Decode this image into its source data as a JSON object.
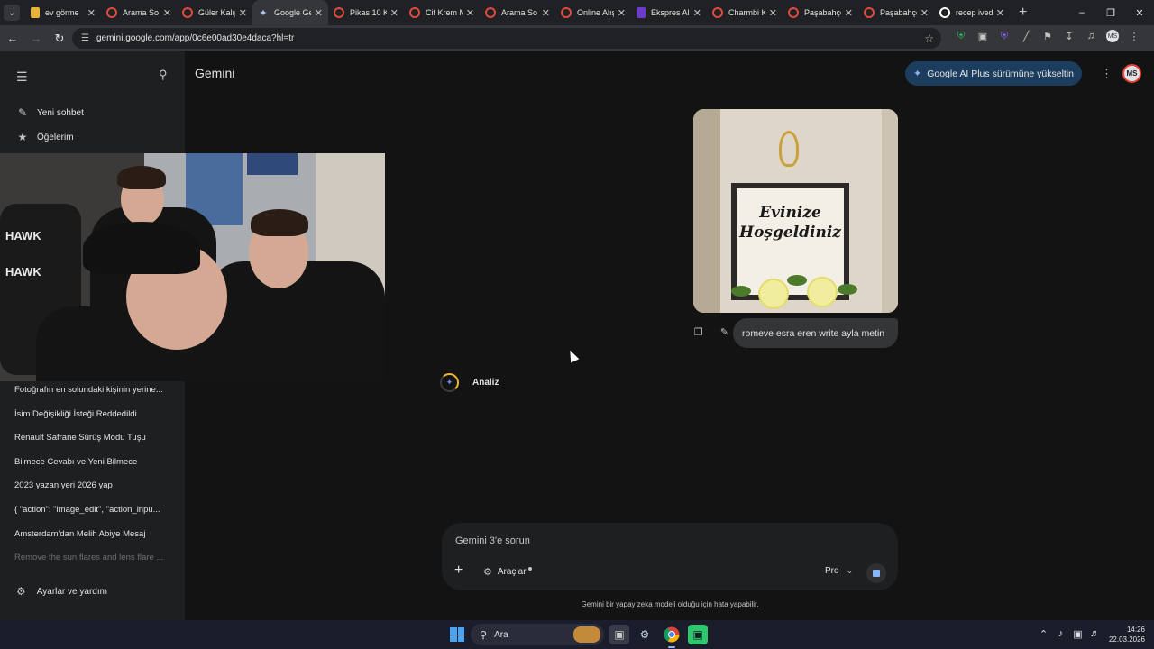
{
  "browser": {
    "tabs": [
      {
        "title": "ev görme",
        "icon": "evgorme-icon",
        "active": false
      },
      {
        "title": "Arama So",
        "icon": "tab-circle-icon",
        "active": false
      },
      {
        "title": "Güler Kalıp",
        "icon": "tab-circle-icon",
        "active": false
      },
      {
        "title": "Google Ge",
        "icon": "gemini-icon",
        "active": true
      },
      {
        "title": "Pikas 10 K",
        "icon": "tab-circle-icon",
        "active": false
      },
      {
        "title": "Cif Krem M",
        "icon": "tab-circle-icon",
        "active": false
      },
      {
        "title": "Arama So",
        "icon": "tab-circle-icon",
        "active": false
      },
      {
        "title": "Online Alış",
        "icon": "tab-circle-icon",
        "active": false
      },
      {
        "title": "Ekspres Al",
        "icon": "ekspres-icon",
        "active": false
      },
      {
        "title": "Charmbi K",
        "icon": "tab-circle-icon",
        "active": false
      },
      {
        "title": "Paşabahçe",
        "icon": "tab-circle-icon",
        "active": false
      },
      {
        "title": "Paşabahçe",
        "icon": "tab-circle-icon",
        "active": false
      },
      {
        "title": "recep ived",
        "icon": "google-icon",
        "active": false
      }
    ],
    "url": "gemini.google.com/app/0c6e00ad30e4daca?hl=tr",
    "profile_initials": "MS"
  },
  "sidebar": {
    "new_chat": "Yeni sohbet",
    "my_items": "Öğelerim",
    "recent": [
      "Fotoğrafın en solundaki kişinin yerine...",
      "İsim Değişikliği İsteği Reddedildi",
      "Renault Safrane Sürüş Modu Tuşu",
      "Bilmece Cevabı ve Yeni Bilmece",
      "2023 yazan yeri 2026 yap",
      "{ \"action\": \"image_edit\", \"action_inpu...",
      "Amsterdam'dan Melih Abiye Mesaj",
      "Remove the sun flares and lens flare ..."
    ],
    "settings": "Ayarlar ve yardım"
  },
  "webcam": {
    "chair_text_1": "HAWK",
    "chair_text_2": "HAWK"
  },
  "header": {
    "title": "Gemini",
    "upgrade_label": "Google AI Plus sürümüne yükseltin",
    "profile_initials": "MS"
  },
  "conversation": {
    "image_sign_line1": "Evinize",
    "image_sign_line2": "Hoşgeldiniz",
    "user_message": "romeve esra eren write ayla metin",
    "status_label": "Analiz"
  },
  "composer": {
    "placeholder": "Gemini 3'e sorun",
    "tools_label": "Araçlar",
    "mode_label": "Pro",
    "disclaimer": "Gemini bir yapay zeka modeli olduğu için hata yapabilir."
  },
  "taskbar": {
    "search_label": "Ara",
    "time": "14:26",
    "date": "22.03.2026"
  }
}
